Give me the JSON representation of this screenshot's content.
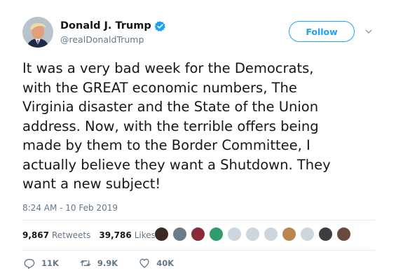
{
  "user": {
    "display_name": "Donald J. Trump",
    "handle": "@realDonaldTrump"
  },
  "follow_label": "Follow",
  "tweet": {
    "text": "It was a very bad week for the Democrats,\nwith the GREAT economic numbers, The\nVirginia disaster and the State of the Union\naddress. Now, with the terrible offers being\nmade by them to the Border Committee, I\nactually believe they want a Shutdown. They\nwant a new subject!",
    "timestamp": "8:24 AM - 10 Feb 2019"
  },
  "stats": {
    "retweets_count": "9,867",
    "retweets_label": "Retweets",
    "likes_count": "39,786",
    "likes_label": "Likes"
  },
  "liker_avatars": [
    "#3a2a22",
    "#6d7a88",
    "#8a2b3a",
    "#2f9c6c",
    "#cdd5dd",
    "#cdd5dd",
    "#cdd5dd",
    "#b8874e",
    "#cdd5dd",
    "#3b3f44",
    "#6a4a3a"
  ],
  "actions": {
    "reply_count": "11K",
    "retweet_count": "9.9K",
    "like_count": "40K"
  },
  "colors": {
    "accent": "#1da1f2",
    "secondary_text": "#657786"
  }
}
